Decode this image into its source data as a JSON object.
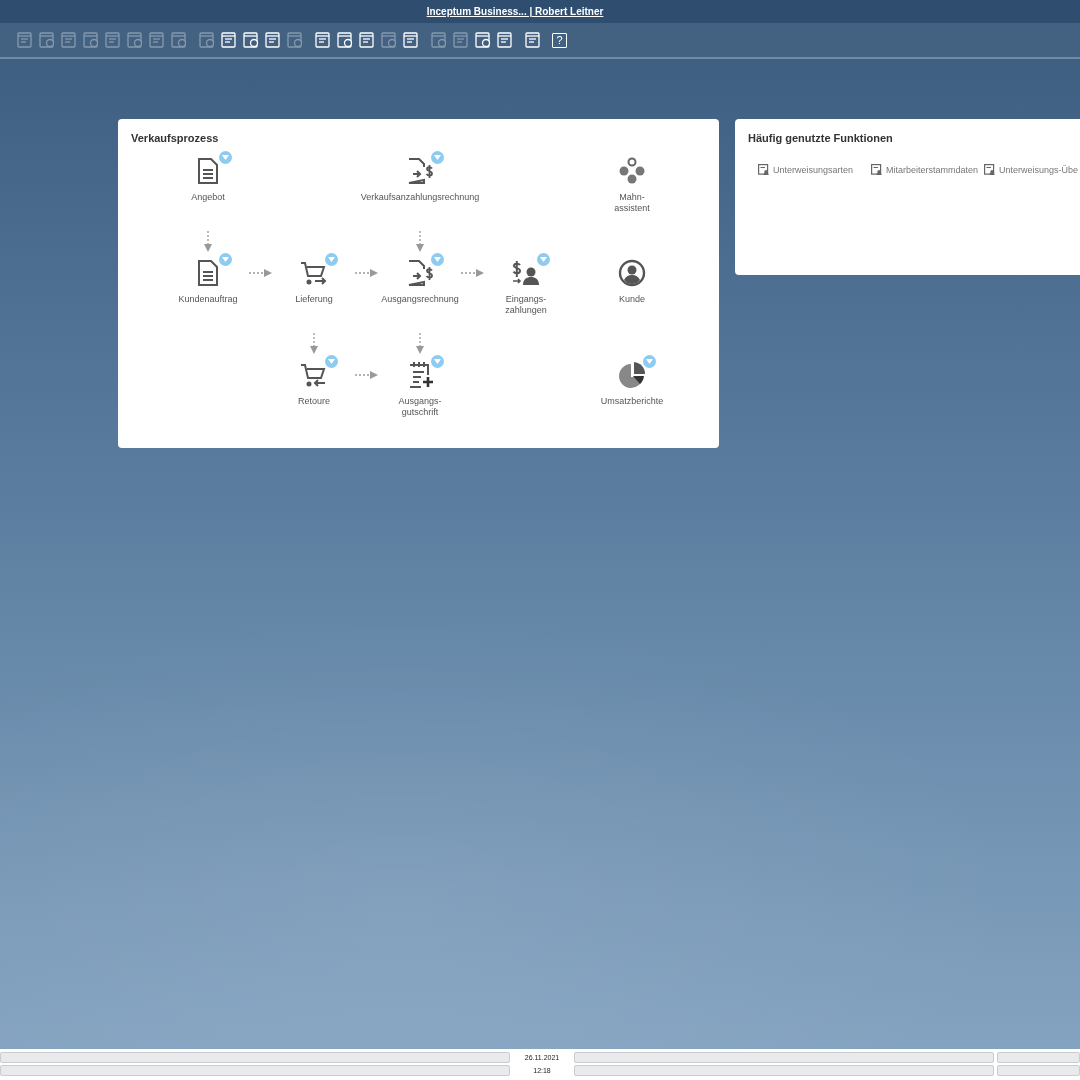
{
  "title_bar": {
    "title": "Inceptum Business... | Robert Leitner"
  },
  "toolbar": {
    "groups": [
      [
        {
          "disabled": true
        },
        {
          "disabled": true
        },
        {
          "disabled": true
        },
        {
          "disabled": true
        },
        {
          "disabled": true
        },
        {
          "disabled": true
        },
        {
          "disabled": true
        },
        {
          "disabled": true
        }
      ],
      [
        {
          "disabled": true
        },
        {
          "disabled": false
        },
        {
          "disabled": false
        },
        {
          "disabled": false
        },
        {
          "disabled": true
        }
      ],
      [
        {
          "disabled": false
        },
        {
          "disabled": false
        },
        {
          "disabled": false
        },
        {
          "disabled": true
        },
        {
          "disabled": false
        }
      ],
      [
        {
          "disabled": true
        },
        {
          "disabled": true
        },
        {
          "disabled": false
        },
        {
          "disabled": false
        }
      ],
      [
        {
          "disabled": false
        }
      ],
      [
        {
          "disabled": false,
          "label": "?"
        }
      ]
    ]
  },
  "sales_process": {
    "title": "Verkaufsprozess",
    "rows": [
      [
        {
          "kind": "node",
          "label": "Angebot",
          "menu": true
        },
        {
          "kind": "empty"
        },
        {
          "kind": "empty"
        },
        {
          "kind": "empty"
        },
        {
          "kind": "node",
          "label": "Verkaufsanzahlungsrechnung",
          "menu": true
        },
        {
          "kind": "empty"
        },
        {
          "kind": "empty"
        },
        {
          "kind": "empty"
        },
        {
          "kind": "node",
          "label": "Mahn-\nassistent",
          "menu": false
        }
      ],
      [
        {
          "kind": "arrow-down"
        },
        {
          "kind": "empty"
        },
        {
          "kind": "empty"
        },
        {
          "kind": "empty"
        },
        {
          "kind": "arrow-down"
        },
        {
          "kind": "empty"
        },
        {
          "kind": "empty"
        },
        {
          "kind": "empty"
        },
        {
          "kind": "empty"
        }
      ],
      [
        {
          "kind": "node",
          "label": "Kundenauftrag",
          "menu": true
        },
        {
          "kind": "arrow-right"
        },
        {
          "kind": "node",
          "label": "Lieferung",
          "menu": true
        },
        {
          "kind": "arrow-right"
        },
        {
          "kind": "node",
          "label": "Ausgangsrechnung",
          "menu": true
        },
        {
          "kind": "arrow-right"
        },
        {
          "kind": "node",
          "label": "Eingangs-\nzahlungen",
          "menu": true
        },
        {
          "kind": "empty"
        },
        {
          "kind": "node",
          "label": "Kunde",
          "menu": false
        }
      ],
      [
        {
          "kind": "empty"
        },
        {
          "kind": "empty"
        },
        {
          "kind": "arrow-down"
        },
        {
          "kind": "empty"
        },
        {
          "kind": "arrow-down"
        },
        {
          "kind": "empty"
        },
        {
          "kind": "empty"
        },
        {
          "kind": "empty"
        },
        {
          "kind": "empty"
        }
      ],
      [
        {
          "kind": "empty"
        },
        {
          "kind": "empty"
        },
        {
          "kind": "node",
          "label": "Retoure",
          "menu": true
        },
        {
          "kind": "arrow-right"
        },
        {
          "kind": "node",
          "label": "Ausgangs-\ngutschrift",
          "menu": true
        },
        {
          "kind": "empty"
        },
        {
          "kind": "empty"
        },
        {
          "kind": "empty"
        },
        {
          "kind": "node",
          "label": "Umsatzberichte",
          "menu": true
        }
      ]
    ]
  },
  "frequent_functions": {
    "title": "Häufig genutzte Funktionen",
    "items": [
      "Unterweisungsarten",
      "Mitarbeiterstammdaten",
      "Unterweisungs-Übe"
    ]
  },
  "status_bar": {
    "date": "26.11.2021",
    "time": "12:18"
  }
}
